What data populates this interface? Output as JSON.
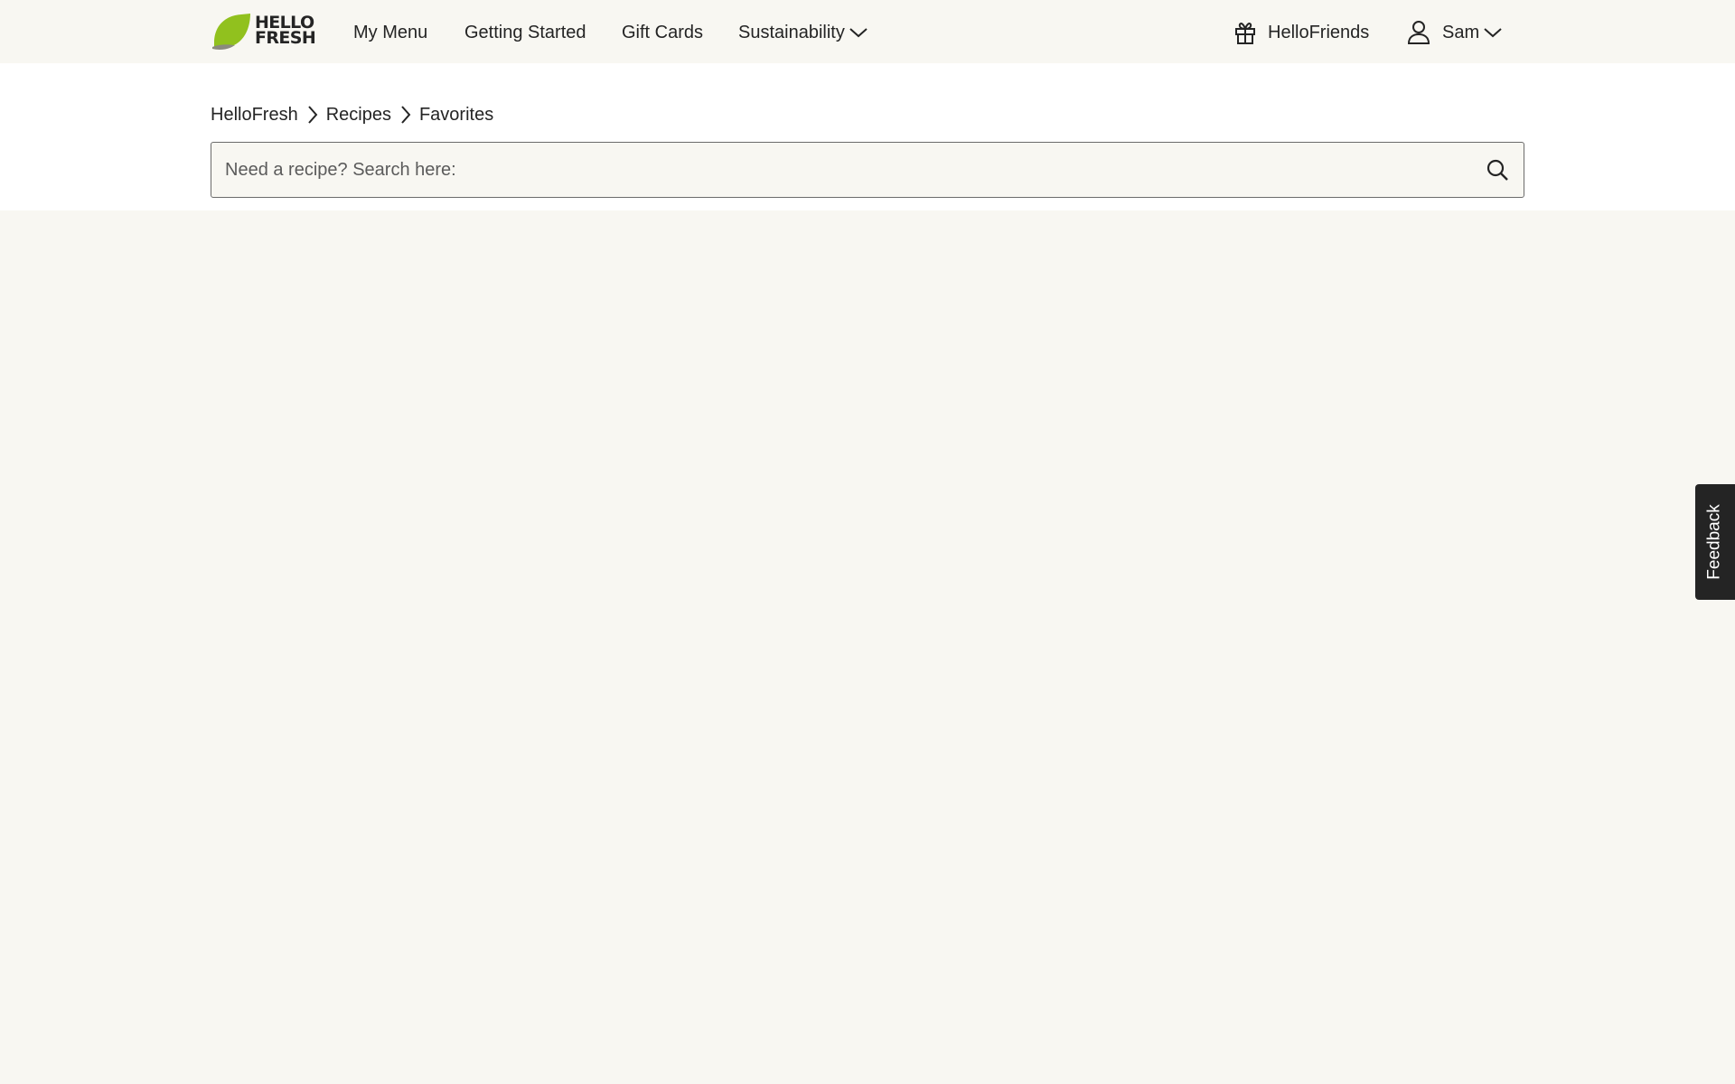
{
  "brand": {
    "logo_line1": "HELLO",
    "logo_line2": "FRESH",
    "leaf_color": "#91c11e"
  },
  "nav": {
    "items": [
      {
        "label": "My Menu"
      },
      {
        "label": "Getting Started"
      },
      {
        "label": "Gift Cards"
      },
      {
        "label": "Sustainability",
        "icon": "chevron-down-icon"
      }
    ],
    "referral": {
      "label": "HelloFriends",
      "icon": "gift-icon"
    },
    "account": {
      "label": "Sam",
      "icon": "user-icon",
      "dropdown_icon": "chevron-down-icon"
    }
  },
  "breadcrumb": {
    "items": [
      "HelloFresh",
      "Recipes",
      "Favorites"
    ],
    "separator_icon": "chevron-right-icon"
  },
  "search": {
    "placeholder": "Need a recipe? Search here:",
    "value": "",
    "icon": "search-icon"
  },
  "feedback": {
    "label": "Feedback"
  },
  "colors": {
    "page_background": "#f8f7f2",
    "subheader_background": "#ffffff",
    "text": "#242424",
    "feedback_background": "#242424"
  }
}
